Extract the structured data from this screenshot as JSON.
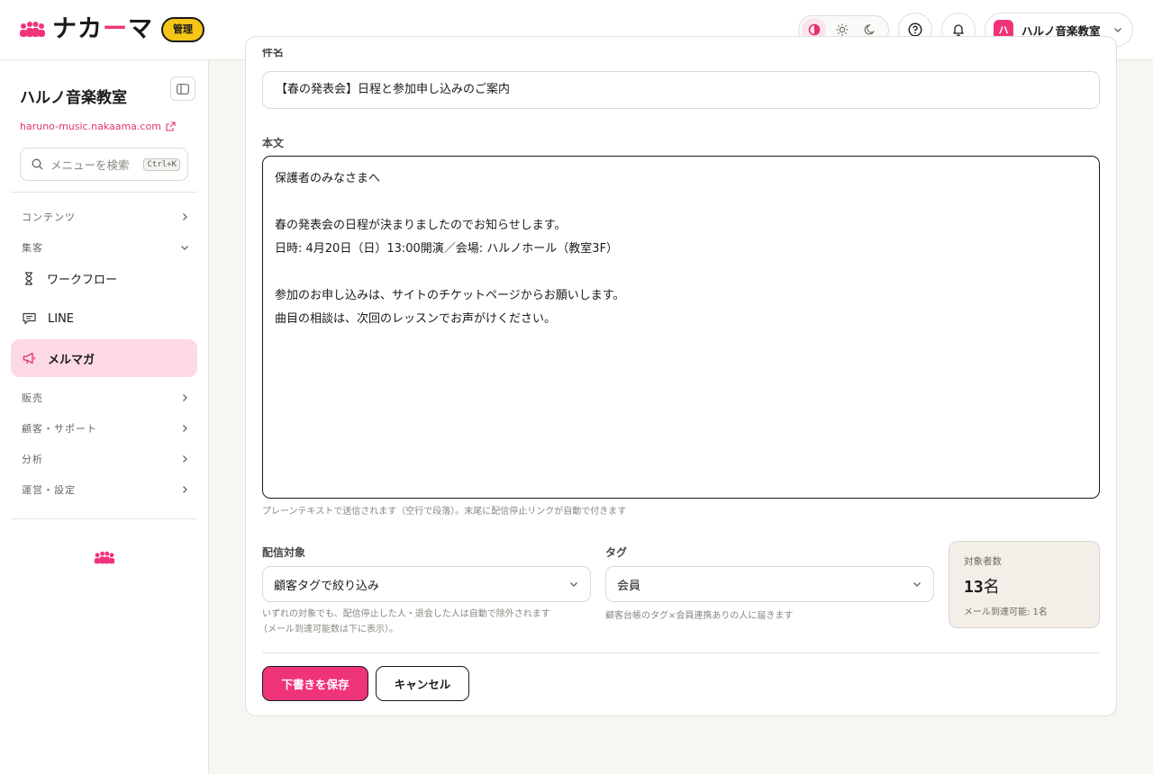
{
  "header": {
    "logo_text_1": "ナカ",
    "logo_text_dash": "ー",
    "logo_text_2": "マ",
    "admin_badge": "管理",
    "account": {
      "avatar_letter": "ハ",
      "name": "ハルノ音楽教室"
    }
  },
  "sidebar": {
    "title": "ハルノ音楽教室",
    "url": "haruno-music.nakaama.com",
    "search_placeholder": "メニューを検索",
    "search_shortcut": "Ctrl+K",
    "sections": {
      "contents": "コンテンツ",
      "marketing": "集客",
      "sales": "販売",
      "customers": "顧客・サポート",
      "analytics": "分析",
      "settings": "運営・設定"
    },
    "items": {
      "workflow": "ワークフロー",
      "line": "LINE",
      "mailmag": "メルマガ"
    }
  },
  "form": {
    "subject_label": "件名",
    "subject_value": "【春の発表会】日程と参加申し込みのご案内",
    "body_label": "本文",
    "body_lines": [
      "保護者のみなさまへ",
      "",
      "春の発表会の日程が決まりましたのでお知らせします。",
      "日時: 4月20日（日）13:00開演／会場: ハルノホール（教室3F）",
      "",
      "参加のお申し込みは、サイトのチケットページからお願いします。",
      "曲目の相談は、次回のレッスンでお声がけください。"
    ],
    "body_help": "プレーンテキストで送信されます（空行で段落）。末尾に配信停止リンクが自動で付きます",
    "target_label": "配信対象",
    "target_value": "顧客タグで絞り込み",
    "target_help_1": "いずれの対象でも、配信停止した人・退会した人は自動で除外されます",
    "target_help_2": "（メール到達可能数は下に表示）。",
    "tag_label": "タグ",
    "tag_value": "会員",
    "tag_help": "顧客台帳のタグ×会員連携ありの人に届きます",
    "count_label": "対象者数",
    "count_number": "13",
    "count_unit": "名",
    "count_reachable": "メール到達可能: 1名",
    "save_button": "下書きを保存",
    "cancel_button": "キャンセル"
  },
  "colors": {
    "brand": "#f0347a",
    "badge": "#f5c518",
    "active_item": "#fdd9e8"
  }
}
